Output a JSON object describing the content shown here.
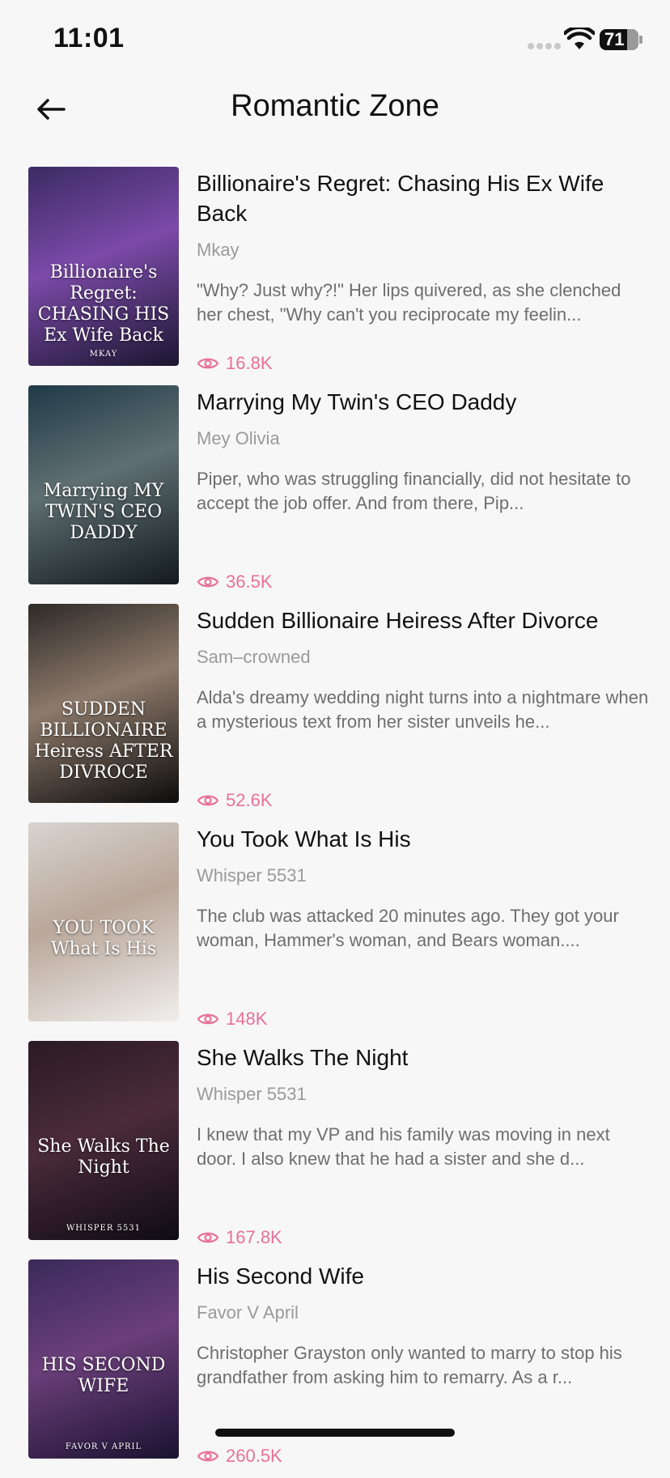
{
  "status": {
    "time": "11:01",
    "battery": "71"
  },
  "header": {
    "title": "Romantic Zone"
  },
  "books": [
    {
      "title": "Billionaire's Regret: Chasing His Ex Wife Back",
      "author": "Mkay",
      "description": "\"Why? Just why?!\" Her lips quivered, as she clenched her chest, \"Why can't you reciprocate my feelin...",
      "views": "16.8K",
      "cover_text": "Billionaire's Regret: CHASING HIS Ex Wife Back",
      "cover_byline": "MKAY",
      "cover_colors": [
        "#3b2b63",
        "#7b4aa8",
        "#1b1630"
      ]
    },
    {
      "title": "Marrying My Twin's CEO Daddy",
      "author": "Mey Olivia",
      "description": "Piper, who was struggling financially, did not hesitate to accept the job offer. And from there, Pip...",
      "views": "36.5K",
      "cover_text": "Marrying MY TWIN'S CEO DADDY",
      "cover_byline": "",
      "cover_colors": [
        "#1f3a47",
        "#5f6f72",
        "#121a1f"
      ]
    },
    {
      "title": "Sudden Billionaire Heiress After Divorce",
      "author": "Sam–crowned",
      "description": "Alda's dreamy wedding night turns into a nightmare when a mysterious text from her sister unveils he...",
      "views": "52.6K",
      "cover_text": "SUDDEN BILLIONAIRE Heiress AFTER DIVROCE",
      "cover_byline": "",
      "cover_colors": [
        "#2d2a27",
        "#8d7a6b",
        "#0c0c0c"
      ]
    },
    {
      "title": "You Took What Is His",
      "author": "Whisper 5531",
      "description": "The club was attacked 20 minutes ago. They got your woman, Hammer's woman, and Bears woman....",
      "views": "148K",
      "cover_text": "YOU TOOK What Is His",
      "cover_byline": "",
      "cover_colors": [
        "#d8d4cf",
        "#b9a79a",
        "#f0eeec"
      ]
    },
    {
      "title": "She Walks The Night",
      "author": "Whisper 5531",
      "description": "I knew that my VP and his family was moving in next door. I also knew that he had a sister and she d...",
      "views": "167.8K",
      "cover_text": "She Walks The Night",
      "cover_byline": "WHISPER 5531",
      "cover_colors": [
        "#2a1a24",
        "#4b2b3a",
        "#0e0b14"
      ]
    },
    {
      "title": "His Second Wife",
      "author": "Favor V April",
      "description": "Christopher Grayston only wanted to marry to stop his grandfather from asking him to remarry. As a r...",
      "views": "260.5K",
      "cover_text": "HIS SECOND WIFE",
      "cover_byline": "FAVOR V APRIL",
      "cover_colors": [
        "#3a2a5a",
        "#6b3f7a",
        "#1a1230"
      ]
    }
  ],
  "accent_color": "#e8719a"
}
